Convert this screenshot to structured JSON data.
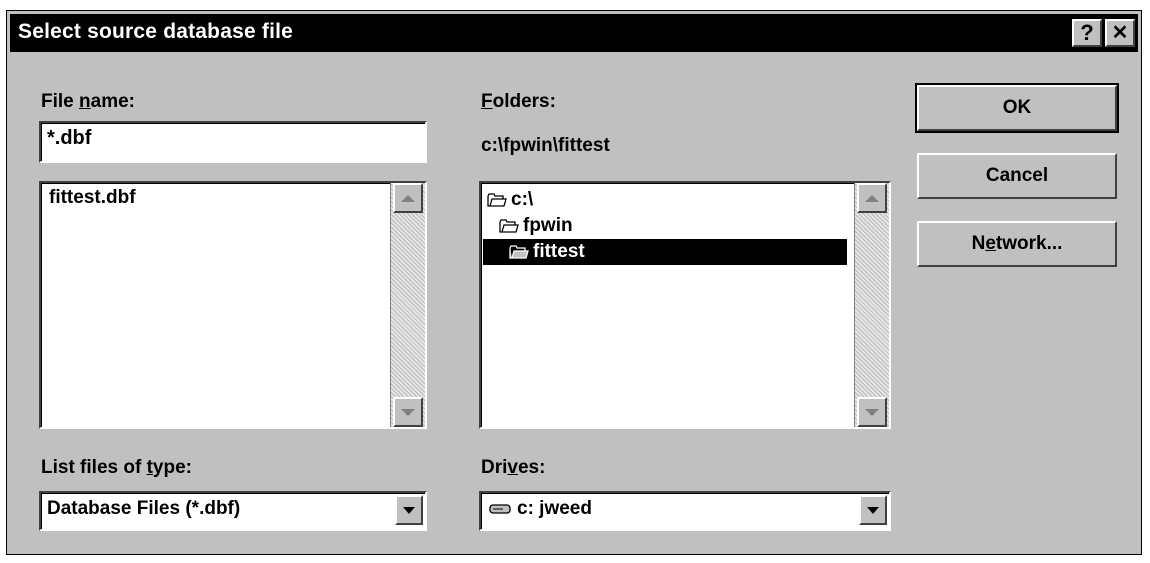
{
  "window": {
    "title": "Select source database file",
    "help_btn": "?",
    "close_btn": "✕"
  },
  "file_name": {
    "label_pre": "File ",
    "label_accel": "n",
    "label_post": "ame:",
    "value": "*.dbf",
    "list": [
      "fittest.dbf"
    ]
  },
  "folders": {
    "label_accel": "F",
    "label_post": "olders:",
    "current_path": "c:\\fpwin\\fittest",
    "tree": [
      "c:\\",
      "fpwin",
      "fittest"
    ]
  },
  "file_type": {
    "label_pre": "List files of ",
    "label_accel": "t",
    "label_post": "ype:",
    "selected": "Database Files (*.dbf)"
  },
  "drives": {
    "label_pre": "Dri",
    "label_accel": "v",
    "label_post": "es:",
    "selected": "c: jweed"
  },
  "buttons": {
    "ok": "OK",
    "cancel": "Cancel",
    "network_pre": "N",
    "network_accel": "e",
    "network_post": "twork..."
  },
  "icons": {
    "open_folder": "open-folder-icon",
    "drive": "hard-drive-icon"
  },
  "colors": {
    "face": "#c0c0c0",
    "titlebar": "#000000",
    "selection": "#000000"
  }
}
